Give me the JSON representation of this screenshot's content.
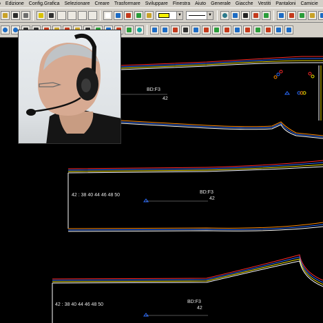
{
  "menu": [
    "o",
    "Edizione",
    "Config.Grafica",
    "Selezionare",
    "Creare",
    "Trasformare",
    "Sviluppare",
    "Finestra",
    "Aiuto",
    "Generale",
    "Giacche",
    "Vestiti",
    "Pantaloni",
    "Camicie",
    "S"
  ],
  "toolbar1": {
    "color_value": "#f5f000",
    "icons_left": [
      "open-icon",
      "save-icon",
      "print-icon",
      "measure-icon",
      "mirror-icon",
      "blank-icon",
      "blank-icon",
      "blank-icon",
      "blank-icon",
      "frame-icon",
      "piece-icon",
      "pattern-icon",
      "shape-icon",
      "grade-icon"
    ],
    "icons_right": [
      "pin-icon",
      "info-icon",
      "select-arrow-icon",
      "cut-icon",
      "copy-icon",
      "paste-icon",
      "piece-view-icon",
      "layer-icon",
      "notch-icon",
      "marker-icon",
      "table-icon"
    ]
  },
  "toolbar2": {
    "icons": [
      "zoom-icon",
      "zoom-in-icon",
      "undo-icon",
      "redo-icon",
      "line-icon",
      "arc-icon",
      "ruler-icon",
      "rotate-icon",
      "delete-icon",
      "pencil-icon",
      "help-icon",
      "frame-icon",
      "fold-icon",
      "seam-icon",
      "number-40-icon",
      "box-icon",
      "percent-icon",
      "chart-icon",
      "grid-icon",
      "stitch-icon",
      "measure-icon",
      "point-icon",
      "plus-icon",
      "square-icon",
      "square-icon"
    ]
  },
  "pieces": [
    {
      "name": "BD:F3",
      "size": "42"
    },
    {
      "name": "BD:F3",
      "size": "42",
      "size_run": "42 : 38 40 44 46 48 50"
    },
    {
      "name": "BD:F3",
      "size": "42",
      "size_run": "42 : 38 40 44 46 48 50"
    }
  ],
  "colors": {
    "ui_face": "#d4d0c8",
    "canvas": "#000000",
    "outline_white": "#ffffff",
    "grade_orange": "#ff8c00",
    "grade_blue": "#2a6cff",
    "grade_yellow": "#f0e000",
    "grade_red": "#ff2a2a"
  },
  "webcam": {
    "subject": "presenter-with-headset"
  }
}
